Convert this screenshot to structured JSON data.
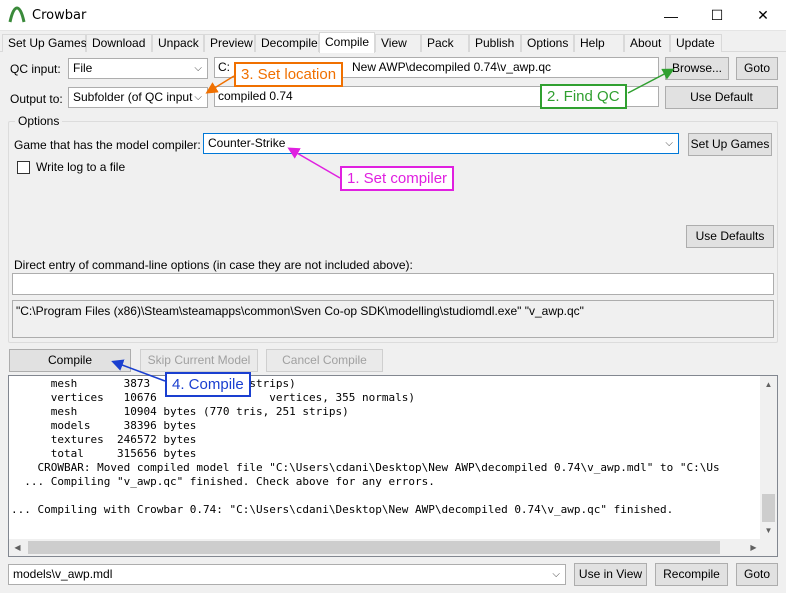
{
  "window": {
    "title": "Crowbar",
    "controls": {
      "minimize": "—",
      "maximize": "☐",
      "close": "✕"
    }
  },
  "tabs": [
    {
      "label": "Set Up Games"
    },
    {
      "label": "Download"
    },
    {
      "label": "Unpack"
    },
    {
      "label": "Preview"
    },
    {
      "label": "Decompile"
    },
    {
      "label": "Compile",
      "active": true
    },
    {
      "label": "View"
    },
    {
      "label": "Pack"
    },
    {
      "label": "Publish"
    },
    {
      "label": "Options"
    },
    {
      "label": "Help"
    },
    {
      "label": "About"
    },
    {
      "label": "Update"
    }
  ],
  "compile": {
    "qc_input_label": "QC input:",
    "qc_input_mode": "File",
    "qc_input_path_start": "C:",
    "qc_input_path_end": "New AWP\\decompiled 0.74\\v_awp.qc",
    "browse_button": "Browse...",
    "goto_button": "Goto",
    "output_label": "Output to:",
    "output_mode": "Subfolder (of QC input",
    "output_value": "compiled 0.74",
    "use_default_button": "Use Default",
    "options_group_label": "Options",
    "game_label": "Game that has the model compiler:",
    "game_value": "Counter-Strike",
    "setup_games_button": "Set Up Games",
    "write_log_label": "Write log to a file",
    "use_defaults_button": "Use Defaults",
    "direct_entry_label": "Direct entry of command-line options (in case they are not included above):",
    "direct_entry_value": "",
    "command_preview": "\"C:\\Program Files (x86)\\Steam\\steamapps\\common\\Sven Co-op SDK\\modelling\\studiomdl.exe\" \"v_awp.qc\"",
    "compile_button": "Compile",
    "skip_button": "Skip Current Model",
    "cancel_button": "Cancel Compile"
  },
  "log_lines": [
    "      mesh       3873       ris, 79 strips)",
    "      vertices   10676                 vertices, 355 normals)",
    "      mesh       10904 bytes (770 tris, 251 strips)",
    "      models     38396 bytes",
    "      textures  246572 bytes",
    "      total     315656 bytes",
    "    CROWBAR: Moved compiled model file \"C:\\Users\\cdani\\Desktop\\New AWP\\decompiled 0.74\\v_awp.mdl\" to \"C:\\Us",
    "  ... Compiling \"v_awp.qc\" finished. Check above for any errors.",
    "",
    "... Compiling with Crowbar 0.74: \"C:\\Users\\cdani\\Desktop\\New AWP\\decompiled 0.74\\v_awp.qc\" finished."
  ],
  "bottom": {
    "output_file": "models\\v_awp.mdl",
    "use_in_view_button": "Use in View",
    "recompile_button": "Recompile",
    "goto_button": "Goto"
  },
  "annotations": {
    "step1": {
      "text": "1. Set compiler",
      "color": "#e020e0"
    },
    "step2": {
      "text": "2. Find QC",
      "color": "#30a030"
    },
    "step3": {
      "text": "3. Set location",
      "color": "#f07000"
    },
    "step4": {
      "text": "4. Compile",
      "color": "#1a3fd0"
    }
  },
  "colors": {
    "accent_focus": "#0078d7",
    "app_icon": "#3a8a3a"
  }
}
